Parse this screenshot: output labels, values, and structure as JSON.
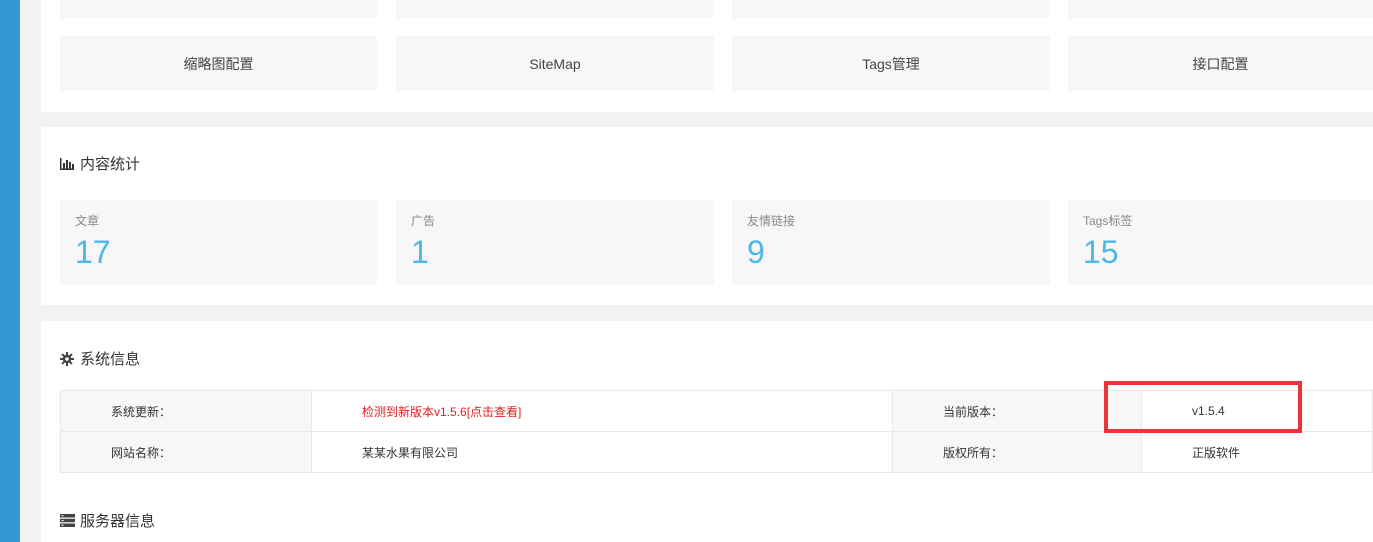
{
  "quick_links": {
    "tiles": [
      "缩略图配置",
      "SiteMap",
      "Tags管理",
      "接口配置"
    ]
  },
  "content_stats": {
    "title": "内容统计",
    "icon": "bar-chart-icon",
    "items": [
      {
        "label": "文章",
        "value": "17"
      },
      {
        "label": "广告",
        "value": "1"
      },
      {
        "label": "友情链接",
        "value": "9"
      },
      {
        "label": "Tags标签",
        "value": "15"
      }
    ]
  },
  "system_info": {
    "title": "系统信息",
    "icon": "gear-icon",
    "rows": [
      {
        "label1": "系统更新：",
        "value1": "检测到新版本v1.5.6[点击查看]",
        "label2": "当前版本：",
        "value2": "v1.5.4"
      },
      {
        "label1": "网站名称：",
        "value1": "某某水果有限公司",
        "label2": "版权所有：",
        "value2": "正版软件"
      }
    ]
  },
  "server_info": {
    "title": "服务器信息",
    "icon": "server-icon"
  },
  "colors": {
    "sidebar": "#3399d3",
    "stat_value": "#4db8e8",
    "alert": "#e02020",
    "highlight": "#e8343a"
  }
}
